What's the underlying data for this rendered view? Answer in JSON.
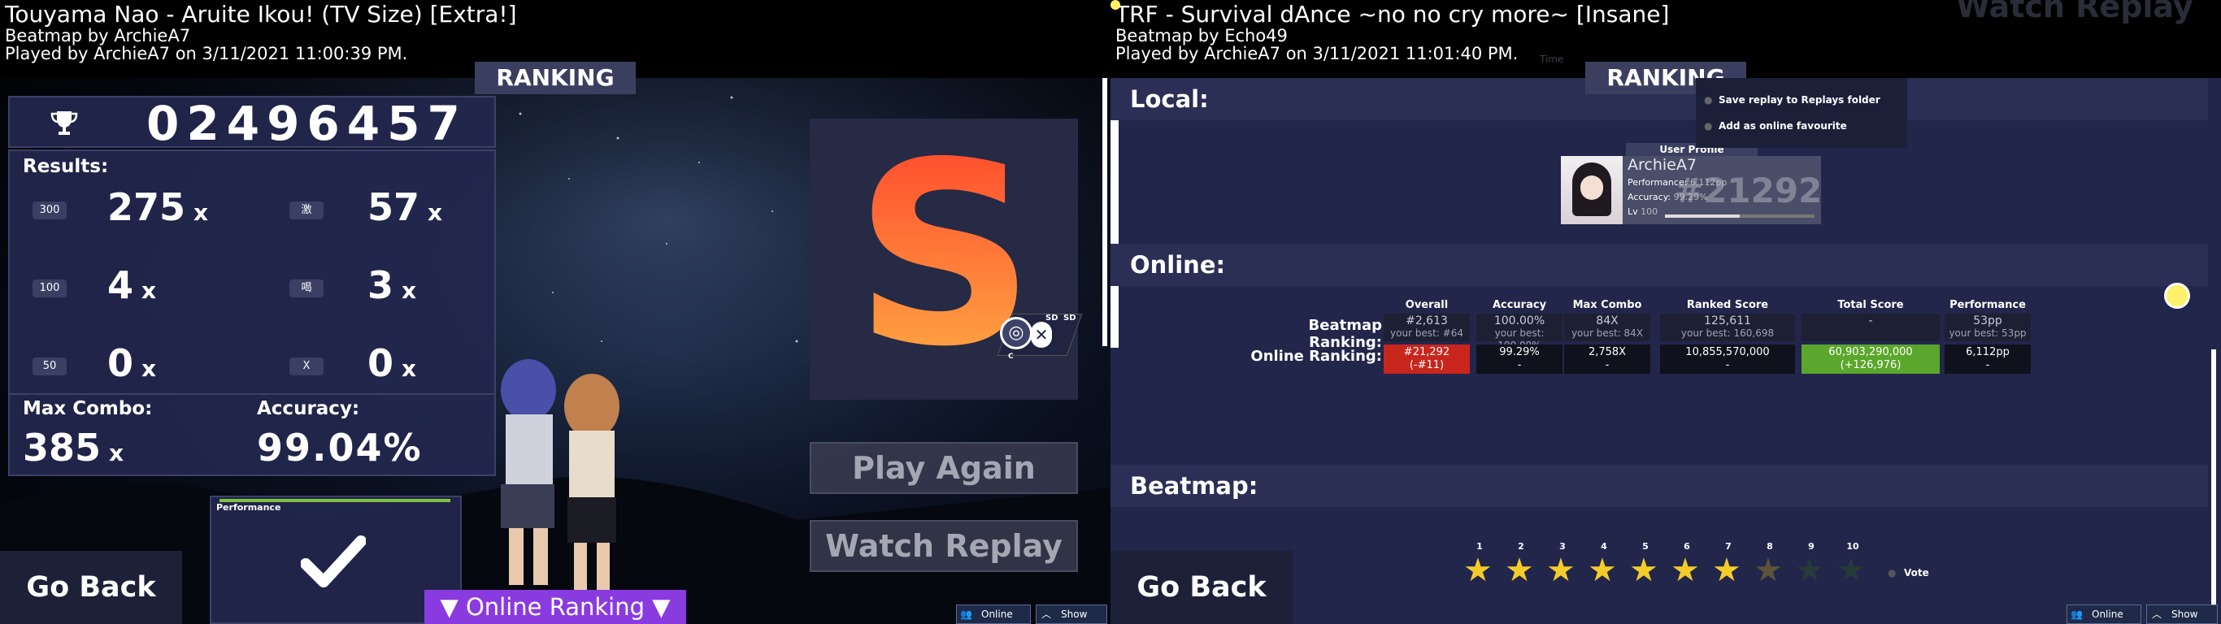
{
  "left": {
    "title": "Touyama Nao - Aruite Ikou! (TV Size) [Extra!]",
    "mapper": "Beatmap by ArchieA7",
    "played": "Played by ArchieA7 on 3/11/2021 11:00:39 PM.",
    "ranking_tab": "RANKING",
    "score": "02496457",
    "results_label": "Results:",
    "hits": [
      {
        "chip": "300",
        "value": "275",
        "suffix": "x"
      },
      {
        "chip": "激",
        "value": "57",
        "suffix": "x"
      },
      {
        "chip": "100",
        "value": "4",
        "suffix": "x"
      },
      {
        "chip": "喝",
        "value": "3",
        "suffix": "x"
      },
      {
        "chip": "50",
        "value": "0",
        "suffix": "x"
      },
      {
        "chip": "X",
        "value": "0",
        "suffix": "x"
      }
    ],
    "max_combo_label": "Max Combo:",
    "max_combo": "385",
    "max_combo_suffix": "x",
    "accuracy_label": "Accuracy:",
    "accuracy": "99.04%",
    "grade": "S",
    "mods": [
      {
        "label": "SD"
      },
      {
        "label": "SD"
      }
    ],
    "mod_c": "C",
    "play_again": "Play Again",
    "watch_replay": "Watch Replay",
    "go_back": "Go Back",
    "performance_label": "Performance",
    "online_ranking": "▼ Online Ranking ▼",
    "online_users": "Online Users",
    "show_chat": "Show Chat",
    "colors": {
      "grade_top": "#ff3f2a",
      "grade_bottom": "#ffb446",
      "accent": "#8a3be0"
    }
  },
  "right": {
    "title": "TRF - Survival dAnce ~no no cry more~ [Insane]",
    "mapper": "Beatmap by Echo49",
    "played": "Played by ArchieA7 on 3/11/2021 11:01:40 PM.",
    "ranking_tab": "RANKING",
    "bg_watch_replay": "Watch Replay",
    "bg_time": "Time",
    "local_label": "Local:",
    "menu": [
      "Save replay to Replays folder",
      "Add as online favourite"
    ],
    "user_profile": "User Profile",
    "user": {
      "name": "ArchieA7",
      "performance_label": "Performance:",
      "performance": "6,112pp",
      "accuracy_label": "Accuracy:",
      "accuracy": "99.29%",
      "level_label": "Lv",
      "level": "100",
      "rank": "#21292"
    },
    "online_label": "Online:",
    "columns": [
      "Overall",
      "Accuracy",
      "Max Combo",
      "Ranked Score",
      "Total Score",
      "Performance"
    ],
    "beatmap_ranking_label": "Beatmap Ranking:",
    "beatmap_ranking": [
      {
        "v": "#2,613",
        "s": "your best: #64"
      },
      {
        "v": "100.00%",
        "s": "your best: 100.00%"
      },
      {
        "v": "84X",
        "s": "your best: 84X"
      },
      {
        "v": "125,611",
        "s": "your best: 160,698"
      },
      {
        "v": "-",
        "s": ""
      },
      {
        "v": "53pp",
        "s": "your best: 53pp"
      }
    ],
    "online_ranking_label": "Online Ranking:",
    "online_ranking": [
      {
        "v": "#21,292",
        "s": "(-#11)"
      },
      {
        "v": "99.29%",
        "s": "-"
      },
      {
        "v": "2,758X",
        "s": "-"
      },
      {
        "v": "10,855,570,000",
        "s": "-"
      },
      {
        "v": "60,903,290,000",
        "s": "(+126,976)"
      },
      {
        "v": "6,112pp",
        "s": "-"
      }
    ],
    "beatmap_label": "Beatmap:",
    "star_numbers": [
      "1",
      "2",
      "3",
      "4",
      "5",
      "6",
      "7",
      "8",
      "9",
      "10"
    ],
    "rating": 7,
    "vote": "Vote",
    "go_back": "Go Back",
    "online_users": "Online Users",
    "show_chat": "Show Chat",
    "colors": {
      "red": "#c8261d",
      "green": "#5ba62c",
      "star": "#f3cc2a"
    }
  }
}
